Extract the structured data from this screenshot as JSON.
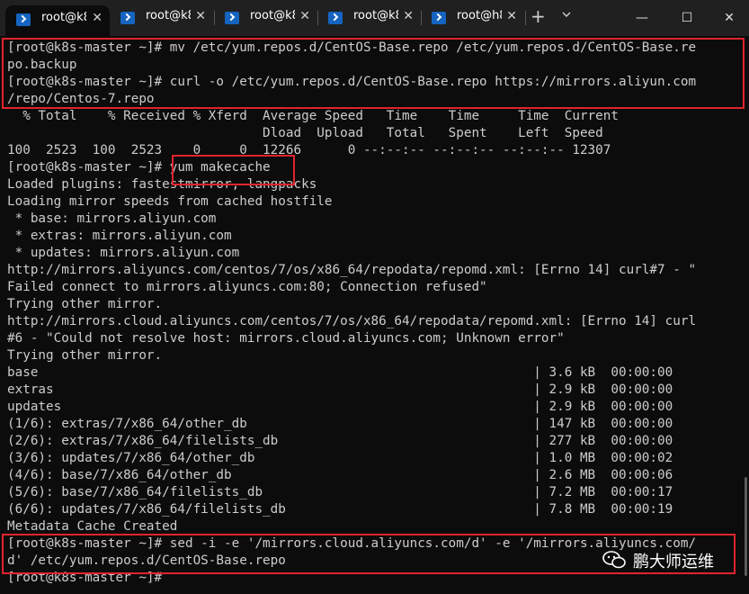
{
  "tabs": [
    {
      "label": "root@k8"
    },
    {
      "label": "root@k8"
    },
    {
      "label": "root@k8"
    },
    {
      "label": "root@k8"
    },
    {
      "label": "root@h8"
    }
  ],
  "window_controls": {
    "minimize": "—",
    "maximize": "☐",
    "close": "✕"
  },
  "terminal": {
    "lines": [
      "[root@k8s-master ~]# mv /etc/yum.repos.d/CentOS-Base.repo /etc/yum.repos.d/CentOS-Base.re",
      "po.backup",
      "[root@k8s-master ~]# curl -o /etc/yum.repos.d/CentOS-Base.repo https://mirrors.aliyun.com",
      "/repo/Centos-7.repo",
      "  % Total    % Received % Xferd  Average Speed   Time    Time     Time  Current",
      "                                 Dload  Upload   Total   Spent    Left  Speed",
      "100  2523  100  2523    0     0  12266      0 --:--:-- --:--:-- --:--:-- 12307",
      "[root@k8s-master ~]# yum makecache",
      "Loaded plugins: fastestmirror, langpacks",
      "Loading mirror speeds from cached hostfile",
      " * base: mirrors.aliyun.com",
      " * extras: mirrors.aliyun.com",
      " * updates: mirrors.aliyun.com",
      "http://mirrors.aliyuncs.com/centos/7/os/x86_64/repodata/repomd.xml: [Errno 14] curl#7 - \"",
      "Failed connect to mirrors.aliyuncs.com:80; Connection refused\"",
      "Trying other mirror.",
      "http://mirrors.cloud.aliyuncs.com/centos/7/os/x86_64/repodata/repomd.xml: [Errno 14] curl",
      "#6 - \"Could not resolve host: mirrors.cloud.aliyuncs.com; Unknown error\"",
      "Trying other mirror.",
      "base                                                                | 3.6 kB  00:00:00",
      "extras                                                              | 2.9 kB  00:00:00",
      "updates                                                             | 2.9 kB  00:00:00",
      "(1/6): extras/7/x86_64/other_db                                     | 147 kB  00:00:00",
      "(2/6): extras/7/x86_64/filelists_db                                 | 277 kB  00:00:00",
      "(3/6): updates/7/x86_64/other_db                                    | 1.0 MB  00:00:02",
      "(4/6): base/7/x86_64/other_db                                       | 2.6 MB  00:00:06",
      "(5/6): base/7/x86_64/filelists_db                                   | 7.2 MB  00:00:17",
      "(6/6): updates/7/x86_64/filelists_db                                | 7.8 MB  00:00:19",
      "Metadata Cache Created",
      "[root@k8s-master ~]# sed -i -e '/mirrors.cloud.aliyuncs.com/d' -e '/mirrors.aliyuncs.com/",
      "d' /etc/yum.repos.d/CentOS-Base.repo",
      "[root@k8s-master ~]#"
    ]
  },
  "watermark": {
    "text": "鹏大师运维"
  },
  "colors": {
    "highlight": "#e0242e",
    "terminal_bg": "#0c0c0c",
    "terminal_fg": "#cccccc",
    "titlebar_bg": "#202020"
  }
}
